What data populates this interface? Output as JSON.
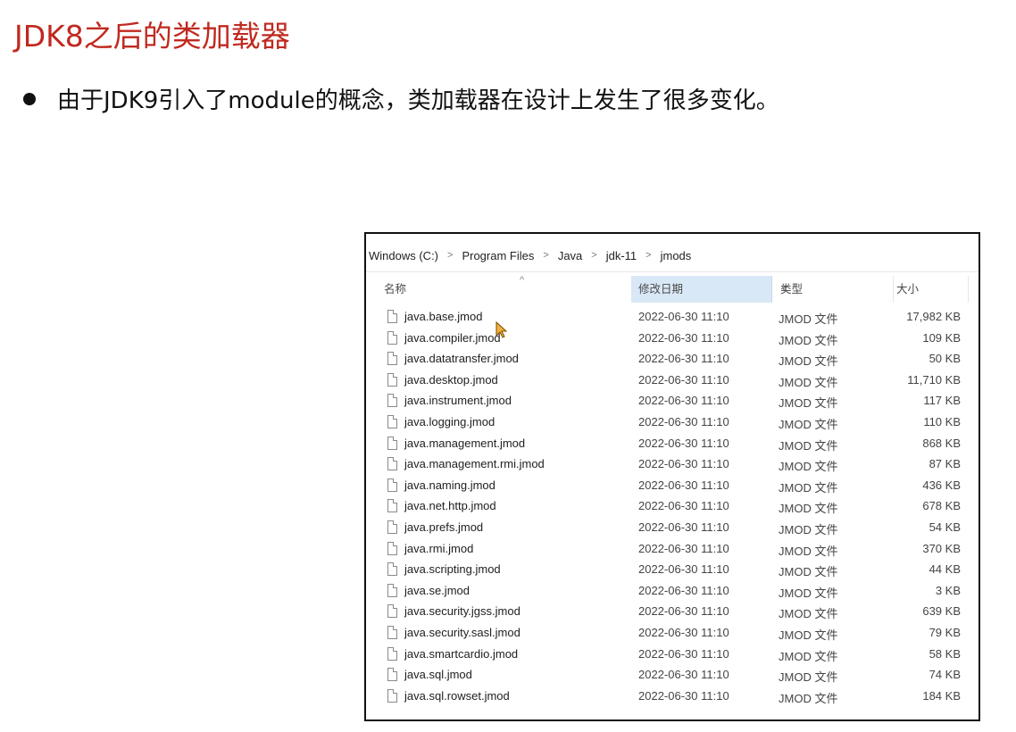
{
  "slide": {
    "title": "JDK8之后的类加载器",
    "bullet": "由于JDK9引入了module的概念，类加载器在设计上发生了很多变化。"
  },
  "explorer": {
    "breadcrumb": [
      "Windows (C:)",
      "Program Files",
      "Java",
      "jdk-11",
      "jmods"
    ],
    "columns": {
      "name": "名称",
      "date": "修改日期",
      "type": "类型",
      "size": "大小"
    },
    "files": [
      {
        "name": "java.base.jmod",
        "date": "2022-06-30 11:10",
        "type": "JMOD 文件",
        "size": "17,982 KB"
      },
      {
        "name": "java.compiler.jmod",
        "date": "2022-06-30 11:10",
        "type": "JMOD 文件",
        "size": "109 KB"
      },
      {
        "name": "java.datatransfer.jmod",
        "date": "2022-06-30 11:10",
        "type": "JMOD 文件",
        "size": "50 KB"
      },
      {
        "name": "java.desktop.jmod",
        "date": "2022-06-30 11:10",
        "type": "JMOD 文件",
        "size": "11,710 KB"
      },
      {
        "name": "java.instrument.jmod",
        "date": "2022-06-30 11:10",
        "type": "JMOD 文件",
        "size": "117 KB"
      },
      {
        "name": "java.logging.jmod",
        "date": "2022-06-30 11:10",
        "type": "JMOD 文件",
        "size": "110 KB"
      },
      {
        "name": "java.management.jmod",
        "date": "2022-06-30 11:10",
        "type": "JMOD 文件",
        "size": "868 KB"
      },
      {
        "name": "java.management.rmi.jmod",
        "date": "2022-06-30 11:10",
        "type": "JMOD 文件",
        "size": "87 KB"
      },
      {
        "name": "java.naming.jmod",
        "date": "2022-06-30 11:10",
        "type": "JMOD 文件",
        "size": "436 KB"
      },
      {
        "name": "java.net.http.jmod",
        "date": "2022-06-30 11:10",
        "type": "JMOD 文件",
        "size": "678 KB"
      },
      {
        "name": "java.prefs.jmod",
        "date": "2022-06-30 11:10",
        "type": "JMOD 文件",
        "size": "54 KB"
      },
      {
        "name": "java.rmi.jmod",
        "date": "2022-06-30 11:10",
        "type": "JMOD 文件",
        "size": "370 KB"
      },
      {
        "name": "java.scripting.jmod",
        "date": "2022-06-30 11:10",
        "type": "JMOD 文件",
        "size": "44 KB"
      },
      {
        "name": "java.se.jmod",
        "date": "2022-06-30 11:10",
        "type": "JMOD 文件",
        "size": "3 KB"
      },
      {
        "name": "java.security.jgss.jmod",
        "date": "2022-06-30 11:10",
        "type": "JMOD 文件",
        "size": "639 KB"
      },
      {
        "name": "java.security.sasl.jmod",
        "date": "2022-06-30 11:10",
        "type": "JMOD 文件",
        "size": "79 KB"
      },
      {
        "name": "java.smartcardio.jmod",
        "date": "2022-06-30 11:10",
        "type": "JMOD 文件",
        "size": "58 KB"
      },
      {
        "name": "java.sql.jmod",
        "date": "2022-06-30 11:10",
        "type": "JMOD 文件",
        "size": "74 KB"
      },
      {
        "name": "java.sql.rowset.jmod",
        "date": "2022-06-30 11:10",
        "type": "JMOD 文件",
        "size": "184 KB"
      }
    ]
  },
  "colors": {
    "title": "#c0291f",
    "header_highlight": "#d9e8f6"
  }
}
